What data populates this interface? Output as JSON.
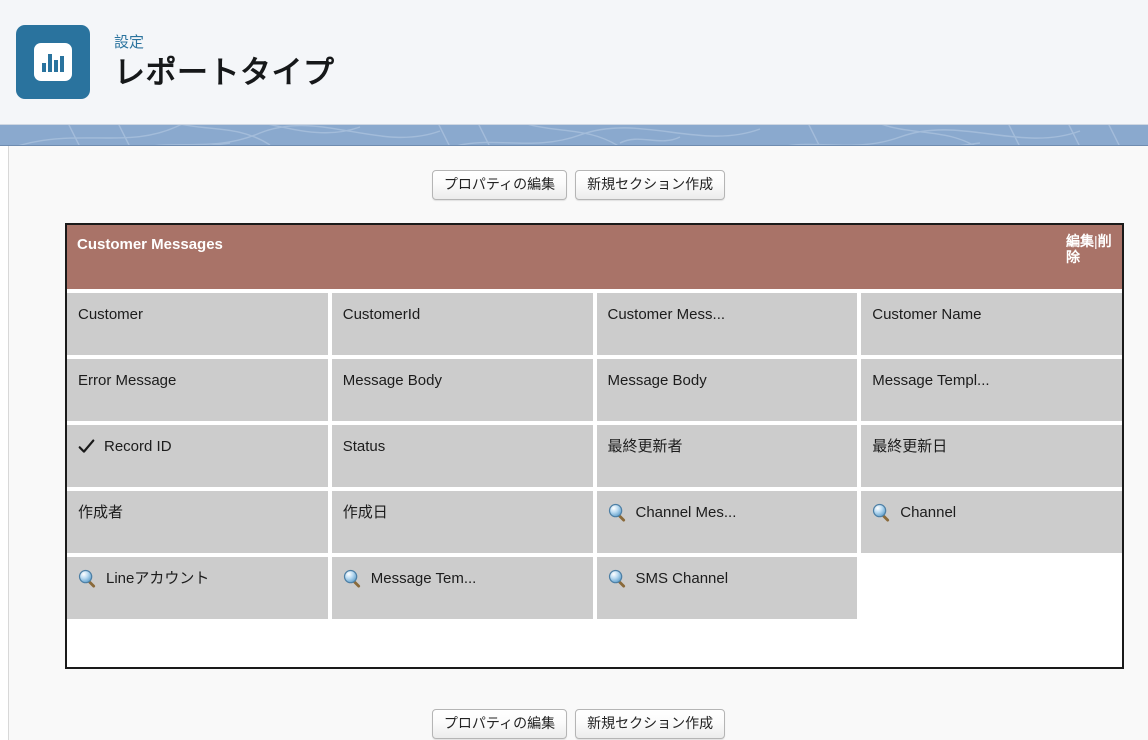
{
  "header": {
    "eyebrow": "設定",
    "title": "レポートタイプ",
    "icon": "report-chart-icon",
    "accent_color": "#2a739e"
  },
  "toolbar": {
    "edit_properties_label": "プロパティの編集",
    "new_section_label": "新規セクション作成"
  },
  "section": {
    "title": "Customer Messages",
    "header_color": "#a97368",
    "edit_label": "編集",
    "separator": "|",
    "delete_label": "削除",
    "cells": [
      {
        "label": "Customer",
        "icon": "none"
      },
      {
        "label": "CustomerId",
        "icon": "none"
      },
      {
        "label": "Customer Mess...",
        "icon": "none"
      },
      {
        "label": "Customer Name",
        "icon": "none"
      },
      {
        "label": "Error Message",
        "icon": "none"
      },
      {
        "label": "Message Body",
        "icon": "none"
      },
      {
        "label": "Message Body",
        "icon": "none"
      },
      {
        "label": "Message Templ...",
        "icon": "none"
      },
      {
        "label": "Record ID",
        "icon": "check"
      },
      {
        "label": "Status",
        "icon": "none"
      },
      {
        "label": "最終更新者",
        "icon": "none"
      },
      {
        "label": "最終更新日",
        "icon": "none"
      },
      {
        "label": "作成者",
        "icon": "none"
      },
      {
        "label": "作成日",
        "icon": "none"
      },
      {
        "label": "Channel Mes...",
        "icon": "lookup"
      },
      {
        "label": "Channel",
        "icon": "lookup"
      },
      {
        "label": "Lineアカウント",
        "icon": "lookup"
      },
      {
        "label": "Message Tem...",
        "icon": "lookup"
      },
      {
        "label": "SMS Channel",
        "icon": "lookup"
      },
      {
        "label": "",
        "icon": "empty"
      }
    ]
  },
  "bottom_toolbar": {
    "edit_properties_label": "プロパティの編集",
    "new_section_label": "新規セクション作成"
  }
}
